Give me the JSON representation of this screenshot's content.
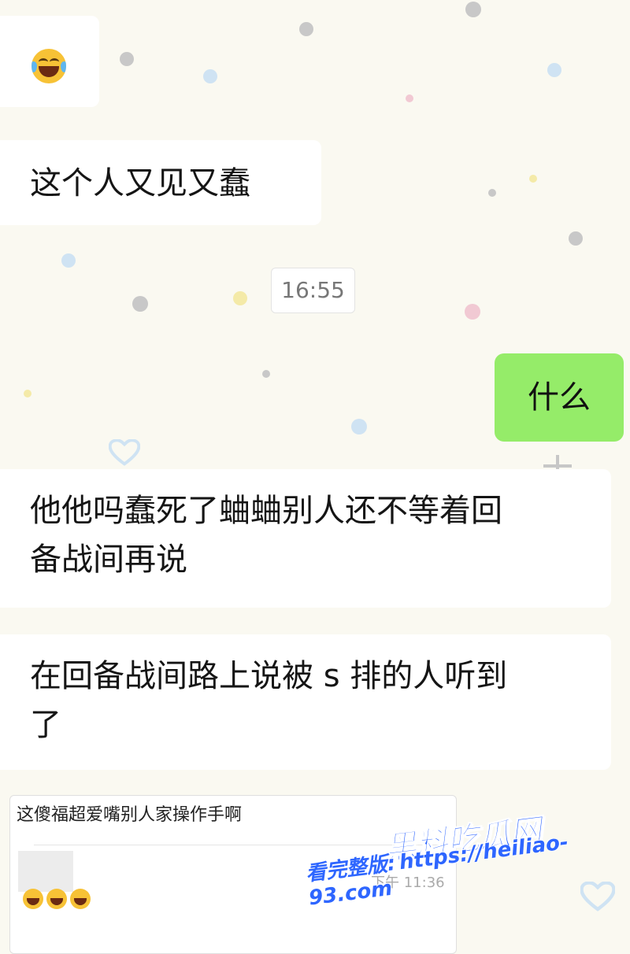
{
  "messages": {
    "emoji_1": "laughing-with-tears-emoji",
    "bubble_1": "这个人又见又蠢",
    "timestamp": "16:55",
    "sent_1": "什么",
    "bubble_2_line1": "他他吗蠢死了蛐蛐别人还不等着回",
    "bubble_2_line2": "备战间再说",
    "bubble_3_line1": "在回备战间路上说被 s 排的人听到",
    "bubble_3_line2": "了"
  },
  "quote": {
    "text": "这傻福超爱嘴别人家操作手啊",
    "time": "下午 11:36"
  },
  "watermark": {
    "brand": "黑料吃瓜网",
    "prefix": "看完整版:",
    "url": "https://heiliao-93.com"
  },
  "colors": {
    "background": "#faf9f1",
    "sent_bubble": "#95ec69",
    "received_bubble": "#ffffff",
    "watermark_blue": "#2e66ff"
  }
}
